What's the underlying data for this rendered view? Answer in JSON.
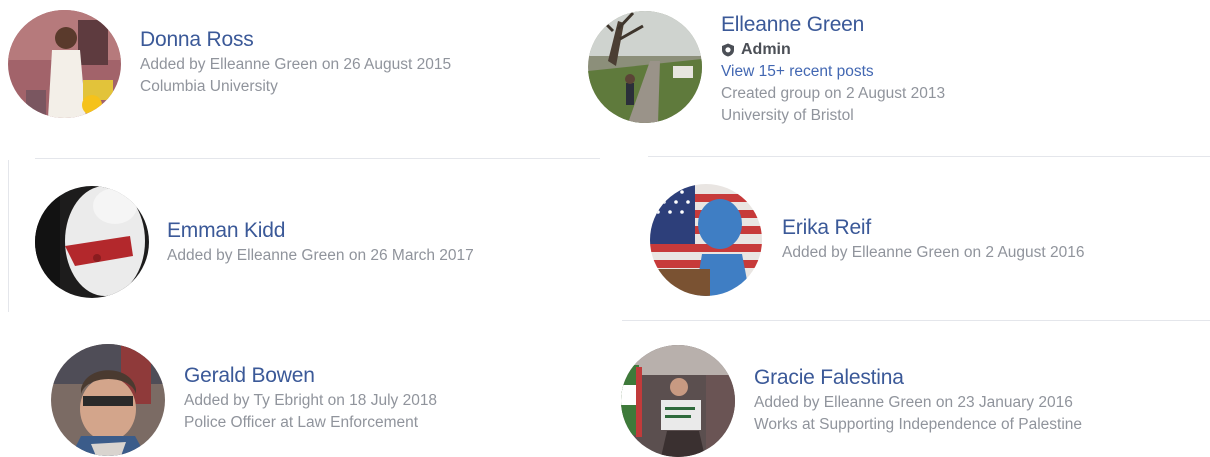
{
  "members": [
    {
      "id": "donna",
      "name": "Donna Ross",
      "lines": [
        "Added by Elleanne Green on 26 August 2015",
        "Columbia University"
      ],
      "avatar_icon": "person-photo-avatar"
    },
    {
      "id": "elleanne",
      "name": "Elleanne Green",
      "badge": "Admin",
      "badge_icon": "shield-icon",
      "link": "View 15+ recent posts",
      "lines": [
        "Created group on 2 August 2013",
        "University of Bristol"
      ],
      "avatar_icon": "park-photo-avatar"
    },
    {
      "id": "emman",
      "name": "Emman Kidd",
      "lines": [
        "Added by Elleanne Green on 26 March 2017"
      ],
      "avatar_icon": "dog-photo-avatar"
    },
    {
      "id": "erika",
      "name": "Erika Reif",
      "lines": [
        "Added by Elleanne Green on 2 August 2016"
      ],
      "avatar_icon": "flag-photo-avatar"
    },
    {
      "id": "gerald",
      "name": "Gerald Bowen",
      "lines": [
        "Added by Ty Ebright on 18 July 2018",
        "Police Officer at Law Enforcement"
      ],
      "avatar_icon": "selfie-photo-avatar"
    },
    {
      "id": "gracie",
      "name": "Gracie Falestina",
      "lines": [
        "Added by Elleanne Green on 23 January 2016",
        "Works at Supporting Independence of Palestine"
      ],
      "avatar_icon": "protest-photo-avatar"
    }
  ],
  "colors": {
    "name_link": "#3b5998",
    "meta_text": "#90949c",
    "accent_link": "#4267b2"
  }
}
